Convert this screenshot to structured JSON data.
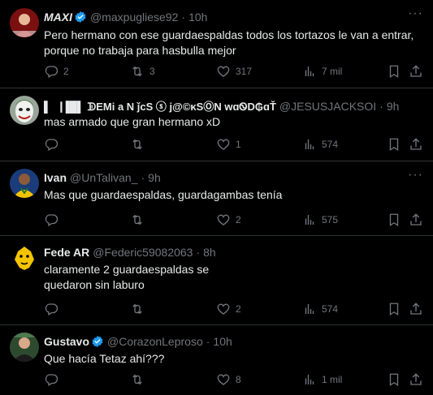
{
  "tweets": [
    {
      "name": "MAXI",
      "handle": "@maxpugliese92",
      "separator": "·",
      "time": "10h",
      "verified": true,
      "text": "Pero hermano con ese guardaespaldas todos los tortazos le van a entrar, porque no trabaja para hasbulla mejor",
      "replies": "2",
      "retweets": "3",
      "likes": "317",
      "views": "7 mil",
      "avatar_color": "#b71c1c"
    },
    {
      "name": "▌▕▐█▌ ᗫЕMi a N ǰcS ⓢ j@©κSⓄN wɑᏫD₲ɑŤ",
      "handle": "@JESUSJACKSOI",
      "separator": "·",
      "time": "9h",
      "verified": false,
      "text": "mas armado que gran hermano xD",
      "replies": "",
      "retweets": "",
      "likes": "1",
      "views": "574",
      "avatar_color": "#c8d2c8"
    },
    {
      "name": "Ivan",
      "handle": "@UnTalivan_",
      "separator": "·",
      "time": "9h",
      "verified": false,
      "text": "Mas que guardaespaldas, guardagambas tenía",
      "replies": "",
      "retweets": "",
      "likes": "2",
      "views": "575",
      "avatar_color": "#f2c200"
    },
    {
      "name": "Fede AR",
      "handle": "@Federic59082063",
      "separator": "·",
      "time": "8h",
      "verified": false,
      "text": "claramente 2 guardaespaldas se quedaron sin laburo",
      "replies": "",
      "retweets": "",
      "likes": "2",
      "views": "574",
      "avatar_color": "#f5c400"
    },
    {
      "name": "Gustavo",
      "handle": "@CorazonLeproso",
      "separator": "·",
      "time": "10h",
      "verified": true,
      "text": "Que hacía Tetaz ahí???",
      "replies": "",
      "retweets": "",
      "likes": "8",
      "views": "1 mil",
      "avatar_color": "#3a5a3a"
    }
  ],
  "colors": {
    "background": "#000000",
    "text": "#e7e9ea",
    "muted": "#71767b",
    "verified": "#1d9bf0",
    "border": "#2f3336"
  }
}
